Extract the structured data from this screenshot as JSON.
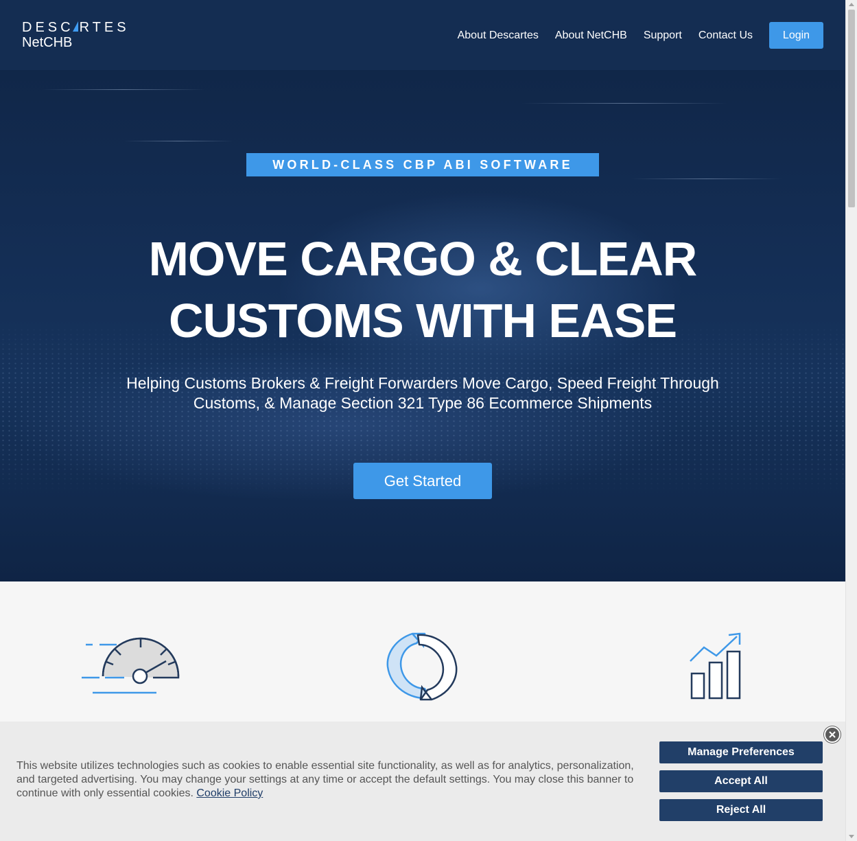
{
  "header": {
    "brand": "DESCARTES",
    "product": "NetCHB",
    "nav": [
      "About Descartes",
      "About NetCHB",
      "Support",
      "Contact Us"
    ],
    "login": "Login"
  },
  "hero": {
    "tagline": "WORLD-CLASS CBP ABI SOFTWARE",
    "headline_1": "MOVE CARGO & CLEAR",
    "headline_2": "CUSTOMS WITH EASE",
    "subhead": "Helping Customs Brokers & Freight Forwarders Move Cargo, Speed Freight Through Customs, & Manage Section 321 Type 86 Ecommerce Shipments",
    "cta": "Get Started"
  },
  "features": {
    "icons": [
      "speedometer-icon",
      "refresh-cycle-icon",
      "growth-chart-icon"
    ]
  },
  "cookie_banner": {
    "message": "This website utilizes technologies such as cookies to enable essential site functionality, as well as for analytics, personalization, and targeted advertising. You may change your settings at any time or accept the default settings. You may close this banner to continue with only essential cookies.",
    "policy_link": "Cookie Policy",
    "manage": "Manage Preferences",
    "accept": "Accept All",
    "reject": "Reject All",
    "close_icon": "close-icon"
  },
  "colors": {
    "accent": "#3e98e8",
    "navy": "#142d52",
    "button_dark": "#213f68"
  }
}
